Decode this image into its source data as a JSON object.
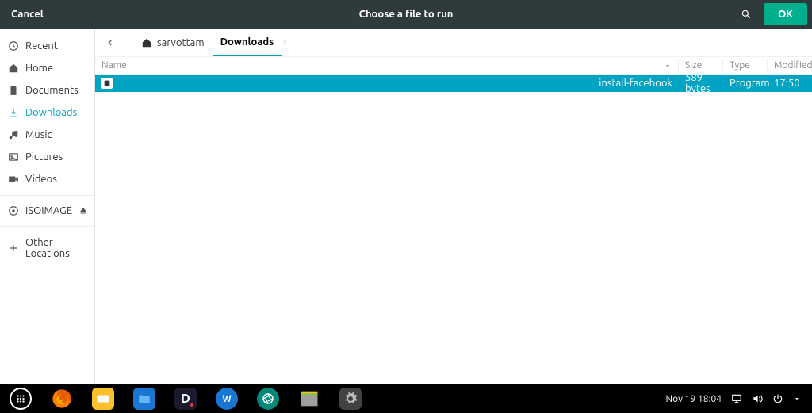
{
  "header": {
    "cancel": "Cancel",
    "title": "Choose a file to run",
    "ok": "OK"
  },
  "sidebar": {
    "items": [
      {
        "icon": "clock",
        "label": "Recent"
      },
      {
        "icon": "home",
        "label": "Home"
      },
      {
        "icon": "doc",
        "label": "Documents"
      },
      {
        "icon": "download",
        "label": "Downloads",
        "active": true
      },
      {
        "icon": "music",
        "label": "Music"
      },
      {
        "icon": "picture",
        "label": "Pictures"
      },
      {
        "icon": "video",
        "label": "Videos"
      }
    ],
    "volumes": [
      {
        "icon": "disc",
        "label": "ISOIMAGE",
        "eject": true
      }
    ],
    "other": [
      {
        "icon": "plus",
        "label": "Other Locations"
      }
    ]
  },
  "breadcrumb": {
    "items": [
      {
        "label": "sarvottam",
        "home": true
      },
      {
        "label": "Downloads",
        "active": true
      }
    ]
  },
  "table": {
    "columns": {
      "name": "Name",
      "size": "Size",
      "type": "Type",
      "modified": "Modified"
    },
    "rows": [
      {
        "name": "install-facebook",
        "size": "589 bytes",
        "type": "Program",
        "modified": "17:50",
        "selected": true
      }
    ]
  },
  "taskbar": {
    "datetime": "Nov 19  18:04"
  }
}
